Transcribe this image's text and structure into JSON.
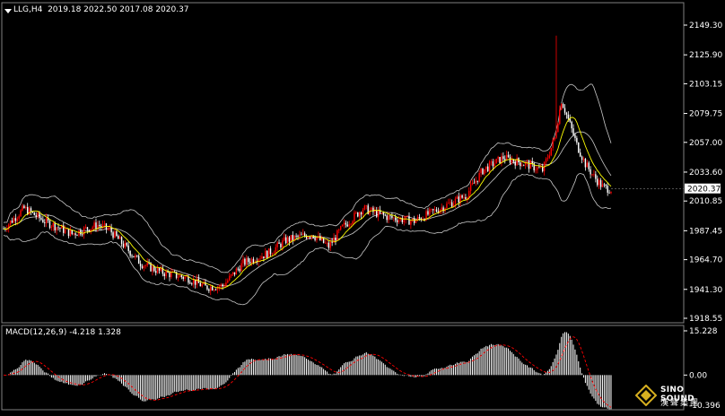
{
  "header": {
    "symbol_label": "LLG,H4  2019.18 2022.50 2017.08 2020.37",
    "macd_label": "MACD(12,26,9) -4.218 1.328"
  },
  "logo": {
    "name": "SINO SOUND",
    "chinese": "漢聲集團"
  },
  "colors": {
    "background": "#000000",
    "bull_candle": "#ff0000",
    "bear_candle": "#ffffff",
    "bollinger": "#c8c8c8",
    "ma_line": "#ffff00",
    "macd_hist": "#ffffff",
    "macd_signal": "#ff0000",
    "price_box": "#ffffff"
  },
  "chart_data": [
    {
      "type": "candlestick",
      "symbol": "LLG",
      "timeframe": "H4",
      "current_price": "2020.37",
      "yticks": [
        "2149.30",
        "2125.90",
        "2103.15",
        "2079.75",
        "2057.00",
        "2033.60",
        "2010.85",
        "1987.45",
        "1964.70",
        "1941.30",
        "1918.55"
      ],
      "ylim": [
        1918.55,
        2149.3
      ],
      "key_points": [
        [
          0,
          1989
        ],
        [
          12,
          2005
        ],
        [
          24,
          1995
        ],
        [
          40,
          1985
        ],
        [
          55,
          1992
        ],
        [
          62,
          1988
        ],
        [
          80,
          1962
        ],
        [
          92,
          1955
        ],
        [
          108,
          1950
        ],
        [
          118,
          1943
        ],
        [
          128,
          1944
        ],
        [
          140,
          1962
        ],
        [
          155,
          1970
        ],
        [
          165,
          1980
        ],
        [
          180,
          1985
        ],
        [
          190,
          1975
        ],
        [
          198,
          1990
        ],
        [
          210,
          2005
        ],
        [
          225,
          1998
        ],
        [
          240,
          1995
        ],
        [
          255,
          2005
        ],
        [
          270,
          2015
        ],
        [
          280,
          2035
        ],
        [
          292,
          2045
        ],
        [
          305,
          2040
        ],
        [
          315,
          2035
        ],
        [
          322,
          2060
        ],
        [
          326,
          2090
        ],
        [
          330,
          2075
        ],
        [
          335,
          2055
        ],
        [
          340,
          2040
        ],
        [
          345,
          2030
        ],
        [
          350,
          2022
        ],
        [
          355,
          2020
        ]
      ],
      "spikes": [
        {
          "i": 323,
          "high": 2141
        }
      ],
      "grid": false
    },
    {
      "type": "macd",
      "params": "12,26,9",
      "main": "-4.218",
      "signal": "1.328",
      "yticks": [
        "15.228",
        "0.00",
        "-10.396"
      ],
      "ylim": [
        -10.396,
        15.228
      ]
    }
  ]
}
